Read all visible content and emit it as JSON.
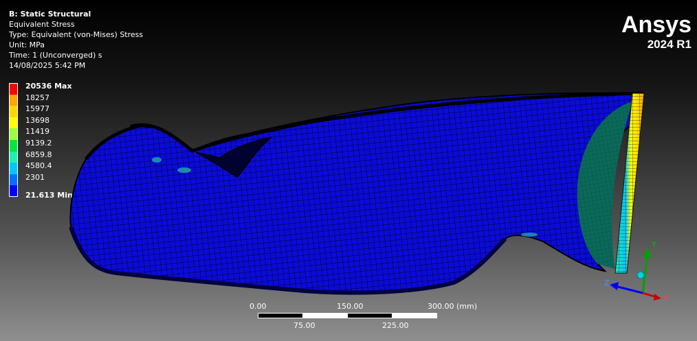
{
  "info": {
    "title": "B: Static Structural",
    "result": "Equivalent Stress",
    "type": "Type: Equivalent (von-Mises) Stress",
    "unit": "Unit: MPa",
    "time": "Time: 1 (Unconverged) s",
    "date": "14/08/2025 5:42 PM"
  },
  "logo": {
    "brand": "Ansys",
    "version": "2024 R1"
  },
  "legend": {
    "max_label": "20536 Max",
    "min_label": "21.613 Min",
    "values": [
      "18257",
      "15977",
      "13698",
      "11419",
      "9139.2",
      "6859.8",
      "4580.4",
      "2301"
    ],
    "colors": [
      "#ff0000",
      "#ffa500",
      "#ffd700",
      "#ffff00",
      "#9aff3c",
      "#00e83a",
      "#1ef0b4",
      "#00c8ff",
      "#0072ff",
      "#0000ff"
    ]
  },
  "scale": {
    "top_left": "0.00",
    "top_mid": "150.00",
    "top_right": "300.00 (mm)",
    "bottom_left": "75.00",
    "bottom_right": "225.00"
  },
  "triad": {
    "x": "X",
    "y": "Y",
    "z": "Z"
  }
}
